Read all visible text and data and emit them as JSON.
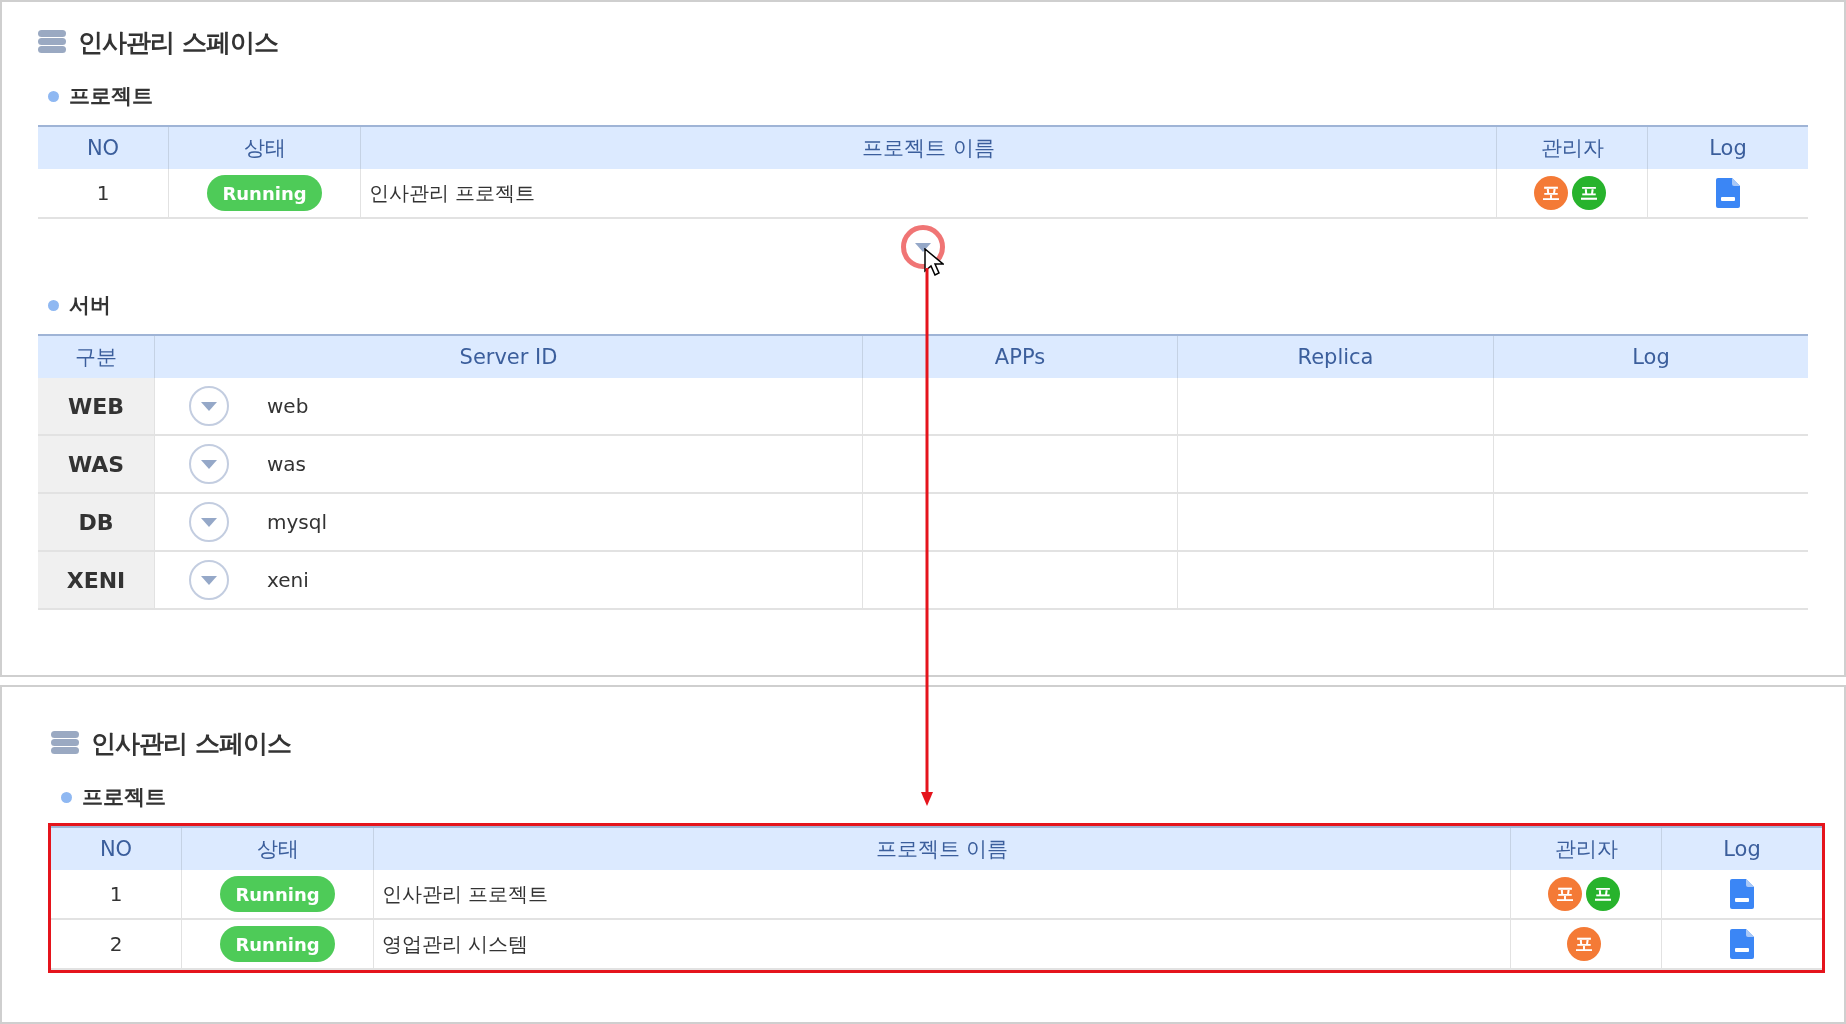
{
  "panels": [
    {
      "title": "인사관리 스페이스",
      "highlighted": false,
      "project": {
        "label": "프로젝트",
        "columns": [
          "NO",
          "상태",
          "프로젝트 이름",
          "관리자",
          "Log"
        ],
        "rows": [
          {
            "no": "1",
            "status": "Running",
            "name": "인사관리 프로젝트",
            "managers": [
              {
                "initial": "포",
                "color": "#f47a36"
              },
              {
                "initial": "프",
                "color": "#27b32c"
              }
            ],
            "log": true
          }
        ]
      },
      "expand_button": {
        "highlighted": true
      },
      "server": {
        "label": "서버",
        "columns": [
          "구분",
          "Server ID",
          "APPs",
          "Replica",
          "Log"
        ],
        "rows": [
          {
            "type": "WEB",
            "id": "web",
            "expanded": false
          },
          {
            "type": "WAS",
            "id": "was",
            "expanded": false
          },
          {
            "type": "DB",
            "id": "mysql",
            "expanded": false
          },
          {
            "type": "XENI",
            "id": "xeni",
            "expanded": false
          }
        ]
      }
    },
    {
      "title": "인사관리 스페이스",
      "highlighted": true,
      "project": {
        "label": "프로젝트",
        "columns": [
          "NO",
          "상태",
          "프로젝트 이름",
          "관리자",
          "Log"
        ],
        "rows": [
          {
            "no": "1",
            "status": "Running",
            "name": "인사관리 프로젝트",
            "managers": [
              {
                "initial": "포",
                "color": "#f47a36"
              },
              {
                "initial": "프",
                "color": "#27b32c"
              }
            ],
            "log": true
          },
          {
            "no": "2",
            "status": "Running",
            "name": "영업관리 시스템",
            "managers": [
              {
                "initial": "포",
                "color": "#f47a36"
              }
            ],
            "log": true
          }
        ]
      }
    }
  ]
}
